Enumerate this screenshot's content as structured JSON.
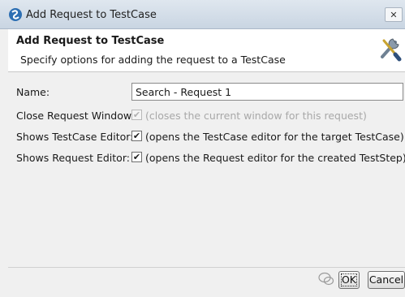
{
  "window": {
    "title": "Add Request to TestCase",
    "close_label": "✕"
  },
  "header": {
    "title": "Add Request to TestCase",
    "description": "Specify options for adding the request to a TestCase"
  },
  "form": {
    "name": {
      "label": "Name:",
      "value": "Search - Request 1"
    },
    "close_request_window": {
      "label": "Close Request Window:",
      "checked": true,
      "enabled": false,
      "description": "(closes the current window for this request)"
    },
    "shows_testcase_editor": {
      "label": "Shows TestCase Editor:",
      "checked": true,
      "enabled": true,
      "description": "(opens the TestCase editor for the target TestCase)"
    },
    "shows_request_editor": {
      "label": "Shows Request Editor:",
      "checked": true,
      "enabled": true,
      "description": "(opens the Request editor for the created TestStep)"
    }
  },
  "buttons": {
    "ok": "OK",
    "cancel": "Cancel"
  },
  "checkmark_glyph": "✔",
  "icons": {
    "app": "soapui-logo-icon",
    "tools": "wrench-screwdriver-icon",
    "watermark": "wechat-watermark-icon"
  },
  "colors": {
    "header_bg": "#ffffff",
    "dialog_bg": "#f0f0f0",
    "titlebar": "#d3dde8"
  }
}
